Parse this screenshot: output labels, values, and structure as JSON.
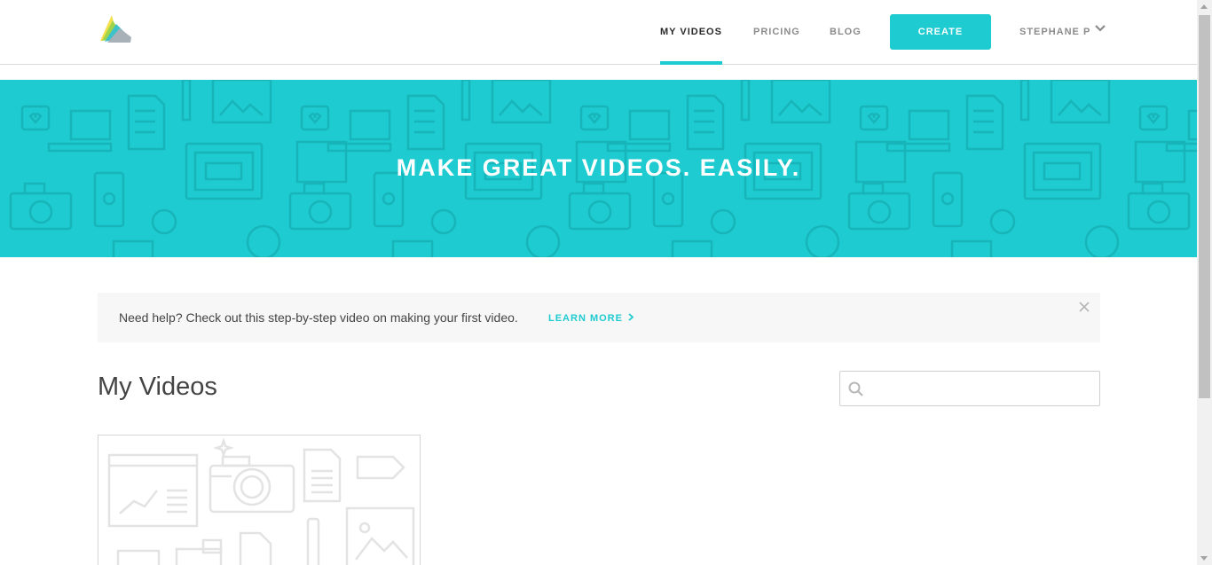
{
  "header": {
    "logo_icon": "animoto-logo-icon",
    "nav": [
      {
        "label": "MY VIDEOS",
        "active": true
      },
      {
        "label": "PRICING",
        "active": false
      },
      {
        "label": "BLOG",
        "active": false
      }
    ],
    "create_label": "CREATE",
    "user_name": "STEPHANE P",
    "user_menu_icon": "chevron-down-icon"
  },
  "hero": {
    "title": "MAKE GREAT VIDEOS. EASILY.",
    "background_color": "#1ecbd0"
  },
  "help_banner": {
    "text": "Need help? Check out this step-by-step video on making your first video.",
    "link_label": "LEARN MORE",
    "link_icon": "chevron-right-icon",
    "close_icon": "close-icon"
  },
  "videos": {
    "title": "My Videos",
    "search_icon": "search-icon",
    "search_value": "",
    "search_placeholder": ""
  },
  "colors": {
    "accent": "#1ecbd0",
    "text_dark": "#2b2b2b",
    "text_muted": "#8c8c8c"
  }
}
